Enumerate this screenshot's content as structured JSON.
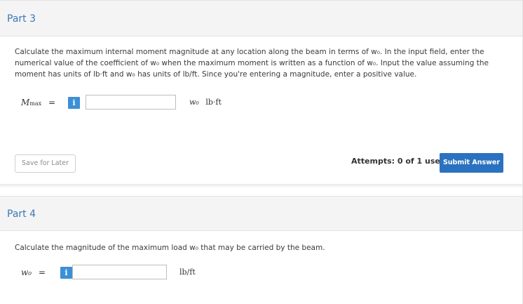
{
  "part3": {
    "title": "Part 3",
    "instructions": "Calculate the maximum internal moment magnitude at any location along the beam in terms of w₀. In the input field, enter the numerical value of the coefficient of w₀ when the maximum moment is written as a function of w₀. Input the value assuming the moment has units of lb·ft and w₀ has units of lb/ft. Since you're entering a magnitude, enter a positive value.",
    "label_main": "M",
    "label_sub": "max",
    "equals": "=",
    "info_icon": "i",
    "input_value": "",
    "units_var": "w₀",
    "units": "lb·ft",
    "save_label": "Save for Later",
    "attempts": "Attempts: 0 of 1 used",
    "submit_label": "Submit Answer"
  },
  "part4": {
    "title": "Part 4",
    "instructions": "Calculate the magnitude of the maximum load w₀ that may be carried by the beam.",
    "label": "w₀",
    "equals": "=",
    "info_icon": "i",
    "input_value": "",
    "units": "lb/ft"
  },
  "colors": {
    "accent": "#2a72c0",
    "title": "#3b78b5",
    "info": "#3b8fd6"
  }
}
